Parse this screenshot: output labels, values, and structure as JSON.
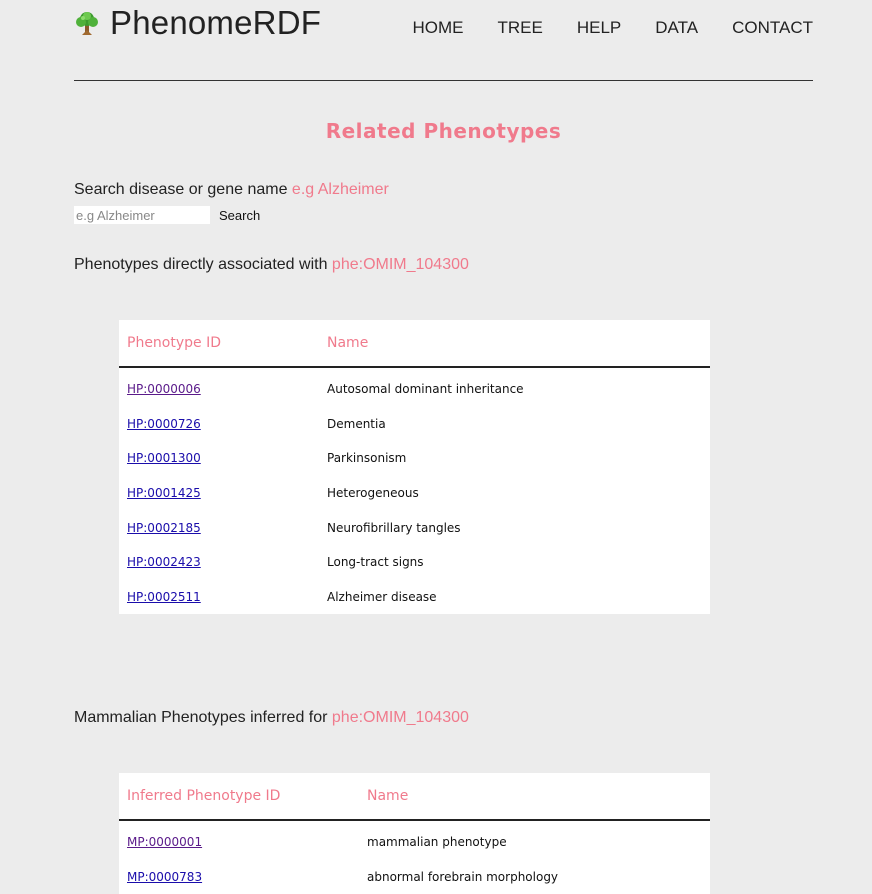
{
  "header": {
    "logo_text": "PhenomeRDF",
    "nav": [
      {
        "label": "HOME"
      },
      {
        "label": "TREE"
      },
      {
        "label": "HELP"
      },
      {
        "label": "DATA"
      },
      {
        "label": "CONTACT"
      }
    ]
  },
  "page_title": "Related Phenotypes",
  "search": {
    "label": "Search disease or gene name",
    "example": "e.g Alzheimer",
    "placeholder": "e.g Alzheimer",
    "value": "",
    "button_label": "Search"
  },
  "direct": {
    "label": "Phenotypes directly associated with",
    "target": "phe:OMIM_104300",
    "columns": [
      "Phenotype ID",
      "Name"
    ],
    "rows": [
      {
        "id": "HP:0000006",
        "name": "Autosomal dominant inheritance"
      },
      {
        "id": "HP:0000726",
        "name": "Dementia"
      },
      {
        "id": "HP:0001300",
        "name": "Parkinsonism"
      },
      {
        "id": "HP:0001425",
        "name": "Heterogeneous"
      },
      {
        "id": "HP:0002185",
        "name": "Neurofibrillary tangles"
      },
      {
        "id": "HP:0002423",
        "name": "Long-tract signs"
      },
      {
        "id": "HP:0002511",
        "name": "Alzheimer disease"
      }
    ]
  },
  "inferred": {
    "label": "Mammalian Phenotypes inferred for",
    "target": "phe:OMIM_104300",
    "columns": [
      "Inferred Phenotype ID",
      "Name"
    ],
    "rows": [
      {
        "id": "MP:0000001",
        "name": "mammalian phenotype"
      },
      {
        "id": "MP:0000783",
        "name": "abnormal forebrain morphology"
      }
    ]
  },
  "colors": {
    "accent": "#f07a8c",
    "background": "#ececec",
    "link": "#1a0dab"
  },
  "icons": {
    "logo": "tree-icon"
  }
}
